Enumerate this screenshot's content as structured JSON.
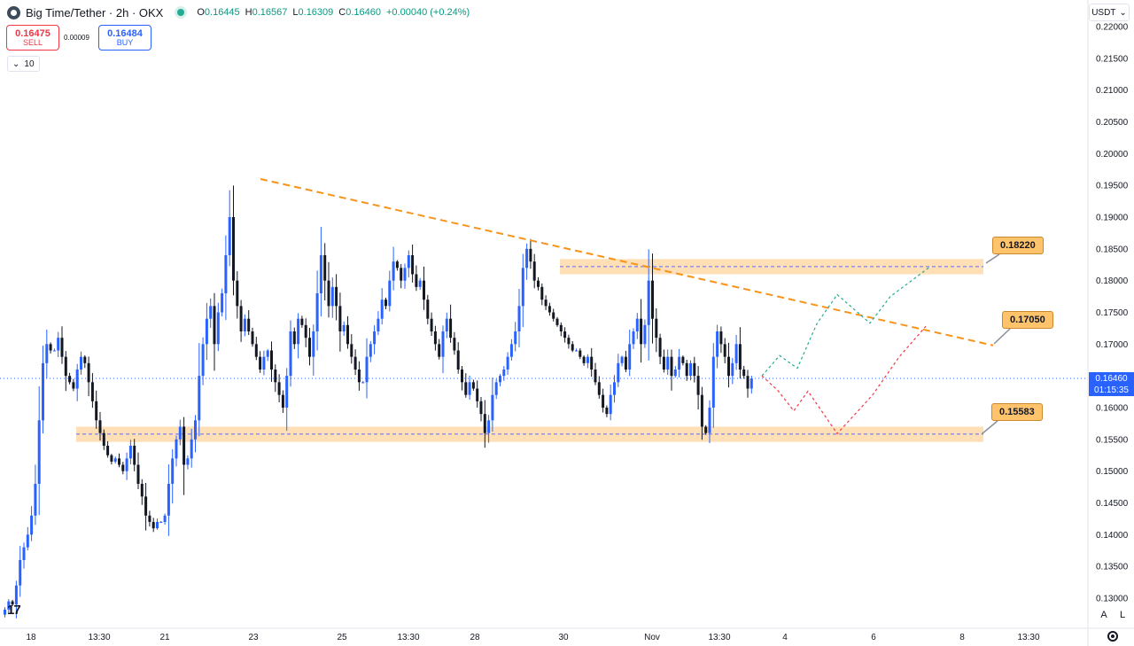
{
  "header": {
    "symbol": "Big Time/Tether · 2h · OKX",
    "ohlc": [
      {
        "k": "O",
        "v": "0.16445"
      },
      {
        "k": "H",
        "v": "0.16567"
      },
      {
        "k": "L",
        "v": "0.16309"
      },
      {
        "k": "C",
        "v": "0.16460"
      }
    ],
    "change": "+0.00040 (+0.24%)"
  },
  "trade": {
    "sell_price": "0.16475",
    "sell_label": "SELL",
    "spread": "0.00009",
    "buy_price": "0.16484",
    "buy_label": "BUY"
  },
  "interval": {
    "chevron": "⌄",
    "value": "10"
  },
  "currency": {
    "label": "USDT",
    "chevron": "⌄"
  },
  "current_price": {
    "price": "0.16460",
    "countdown": "01:15:35"
  },
  "levels": [
    {
      "label": "0.18220"
    },
    {
      "label": "0.17050"
    },
    {
      "label": "0.15583"
    }
  ],
  "scale_buttons": {
    "auto": "A",
    "log": "L"
  },
  "tv_logo": "17",
  "colors": {
    "up": "#2962ff",
    "down": "#131722",
    "trendline": "#f7931a",
    "zone": "#ffd9a8",
    "bull_path": "#22ab94",
    "bear_path": "#f23645",
    "label_bg": "#ffc46b"
  },
  "chart_data": {
    "type": "candlestick",
    "y_ticks": [
      "0.22000",
      "0.21500",
      "0.21000",
      "0.20500",
      "0.20000",
      "0.19500",
      "0.19000",
      "0.18500",
      "0.18000",
      "0.17500",
      "0.17000",
      "0.16500",
      "0.16000",
      "0.15500",
      "0.15000",
      "0.14500",
      "0.14000",
      "0.13500",
      "0.13000"
    ],
    "x_ticks": [
      "18",
      "13:30",
      "21",
      "23",
      "25",
      "13:30",
      "28",
      "30",
      "Nov",
      "13:30",
      "4",
      "6",
      "8",
      "13:30"
    ],
    "ylim": [
      0.1285,
      0.2215
    ],
    "close_path": [
      0.1282,
      0.1295,
      0.129,
      0.132,
      0.136,
      0.138,
      0.14,
      0.143,
      0.148,
      0.158,
      0.167,
      0.17,
      0.169,
      0.169,
      0.171,
      0.168,
      0.165,
      0.164,
      0.163,
      0.166,
      0.168,
      0.167,
      0.164,
      0.161,
      0.158,
      0.156,
      0.154,
      0.1525,
      0.1515,
      0.152,
      0.151,
      0.15,
      0.152,
      0.154,
      0.151,
      0.148,
      0.146,
      0.143,
      0.142,
      0.141,
      0.142,
      0.142,
      0.143,
      0.148,
      0.152,
      0.155,
      0.157,
      0.151,
      0.152,
      0.155,
      0.158,
      0.165,
      0.17,
      0.174,
      0.176,
      0.17,
      0.175,
      0.178,
      0.184,
      0.19,
      0.18,
      0.176,
      0.172,
      0.174,
      0.172,
      0.17,
      0.168,
      0.166,
      0.168,
      0.169,
      0.166,
      0.164,
      0.162,
      0.16,
      0.165,
      0.172,
      0.17,
      0.174,
      0.173,
      0.171,
      0.168,
      0.172,
      0.178,
      0.184,
      0.18,
      0.176,
      0.179,
      0.176,
      0.172,
      0.173,
      0.17,
      0.168,
      0.166,
      0.164,
      0.164,
      0.168,
      0.17,
      0.172,
      0.174,
      0.177,
      0.176,
      0.18,
      0.183,
      0.182,
      0.18,
      0.182,
      0.184,
      0.181,
      0.179,
      0.18,
      0.177,
      0.174,
      0.172,
      0.17,
      0.168,
      0.172,
      0.174,
      0.171,
      0.169,
      0.166,
      0.164,
      0.162,
      0.164,
      0.163,
      0.161,
      0.159,
      0.156,
      0.158,
      0.162,
      0.164,
      0.165,
      0.166,
      0.168,
      0.17,
      0.172,
      0.176,
      0.182,
      0.185,
      0.183,
      0.18,
      0.179,
      0.177,
      0.176,
      0.175,
      0.174,
      0.173,
      0.172,
      0.171,
      0.17,
      0.169,
      0.169,
      0.168,
      0.167,
      0.168,
      0.166,
      0.164,
      0.162,
      0.16,
      0.159,
      0.162,
      0.164,
      0.167,
      0.168,
      0.166,
      0.17,
      0.172,
      0.174,
      0.17,
      0.173,
      0.18,
      0.174,
      0.171,
      0.168,
      0.166,
      0.168,
      0.165,
      0.166,
      0.168,
      0.167,
      0.165,
      0.167,
      0.165,
      0.162,
      0.157,
      0.156,
      0.16,
      0.168,
      0.172,
      0.17,
      0.168,
      0.165,
      0.167,
      0.17,
      0.166,
      0.165,
      0.163,
      0.1646
    ],
    "zones": [
      {
        "value": 0.1822,
        "top": 0.1834,
        "bottom": 0.181
      },
      {
        "value": 0.15583,
        "top": 0.157,
        "bottom": 0.1546
      }
    ],
    "trendline": {
      "from": {
        "x": "23",
        "y": 0.196
      },
      "to": {
        "x": "8",
        "y": 0.1698
      }
    },
    "projection_bull": [
      0.165,
      0.1682,
      0.1662,
      0.1732,
      0.1778,
      0.1733,
      0.1775,
      0.1822
    ],
    "projection_bear": [
      0.165,
      0.1627,
      0.1595,
      0.1626,
      0.1559,
      0.162,
      0.168,
      0.1728
    ]
  }
}
